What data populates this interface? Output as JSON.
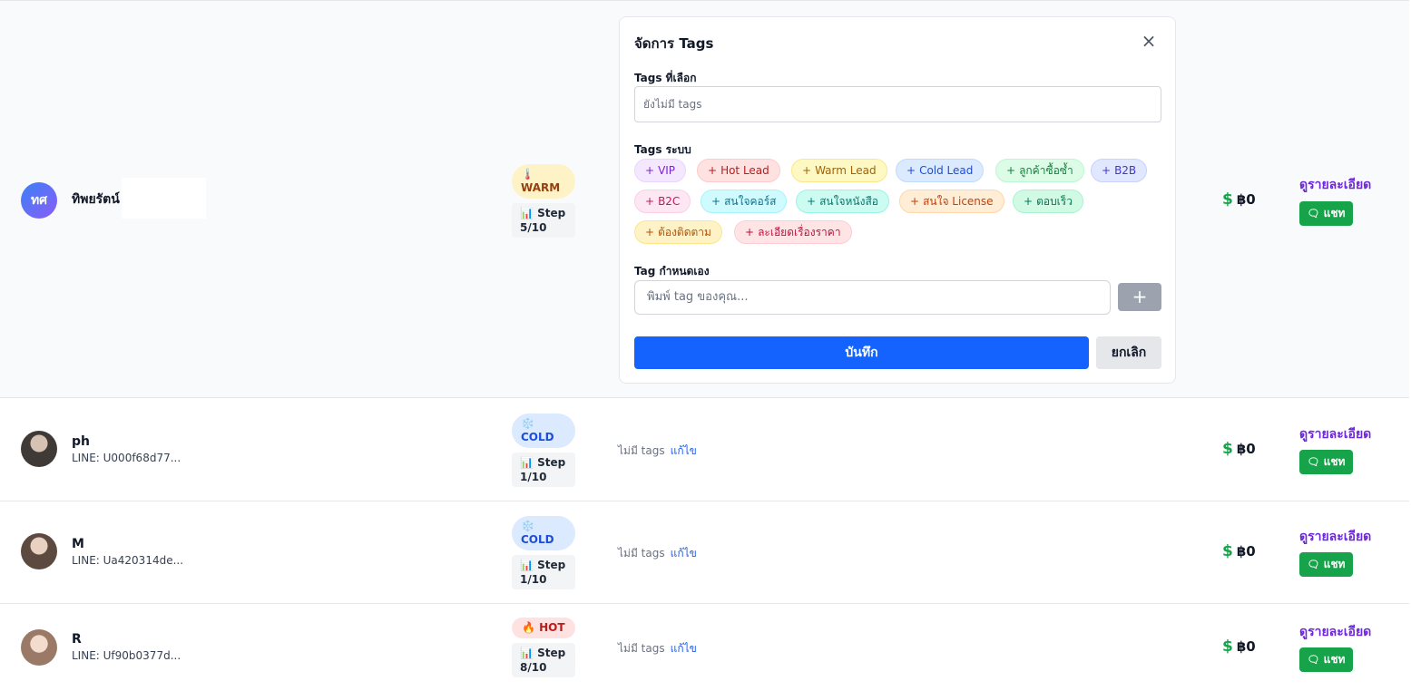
{
  "rows": [
    {
      "avatar_initials": "ทศ",
      "name": "ทิพยรัตน์",
      "line_id": "",
      "temperature": {
        "icon": "🌡️",
        "label": "WARM"
      },
      "step": {
        "icon": "📊",
        "label": "Step",
        "value": "5/10"
      },
      "amount": {
        "currency_icon": "$",
        "value": "฿0"
      },
      "detail_label": "ดูรายละเอียด",
      "chat_label": "แชท"
    },
    {
      "name": "ph",
      "line_id": "LINE: U000f68d77...",
      "temperature": {
        "icon": "❄️",
        "label": "COLD"
      },
      "step": {
        "icon": "📊",
        "label": "Step",
        "value": "1/10"
      },
      "tags_empty": "ไม่มี tags",
      "edit_label": "แก้ไข",
      "amount": {
        "currency_icon": "$",
        "value": "฿0"
      },
      "detail_label": "ดูรายละเอียด",
      "chat_label": "แชท"
    },
    {
      "name": "M",
      "line_id": "LINE: Ua420314de...",
      "temperature": {
        "icon": "❄️",
        "label": "COLD"
      },
      "step": {
        "icon": "📊",
        "label": "Step",
        "value": "1/10"
      },
      "tags_empty": "ไม่มี tags",
      "edit_label": "แก้ไข",
      "amount": {
        "currency_icon": "$",
        "value": "฿0"
      },
      "detail_label": "ดูรายละเอียด",
      "chat_label": "แชท"
    },
    {
      "name": "R",
      "line_id": "LINE: Uf90b0377d...",
      "temperature": {
        "icon": "🔥",
        "label": "HOT"
      },
      "step": {
        "icon": "📊",
        "label": "Step",
        "value": "8/10"
      },
      "tags_empty": "ไม่มี tags",
      "edit_label": "แก้ไข",
      "amount": {
        "currency_icon": "$",
        "value": "฿0"
      },
      "detail_label": "ดูรายละเอียด",
      "chat_label": "แชท"
    }
  ],
  "tag_panel": {
    "title": "จัดการ Tags",
    "close_icon": "×",
    "selected_label": "Tags ที่เลือก",
    "selected_placeholder": "ยังไม่มี tags",
    "system_label": "Tags ระบบ",
    "system_tags": [
      "VIP",
      "Hot Lead",
      "Warm Lead",
      "Cold Lead",
      "ลูกค้าซื้อซ้ำ",
      "B2B",
      "B2C",
      "สนใจคอร์ส",
      "สนใจหนังสือ",
      "สนใจ License",
      "ตอบเร็ว",
      "ต้องติดตาม",
      "ละเอียดเรื่องราคา"
    ],
    "plus_icon": "+",
    "custom_label": "Tag กำหนดเอง",
    "custom_placeholder": "พิมพ์ tag ของคุณ...",
    "add_button": "+",
    "save_label": "บันทึก",
    "cancel_label": "ยกเลิก"
  }
}
